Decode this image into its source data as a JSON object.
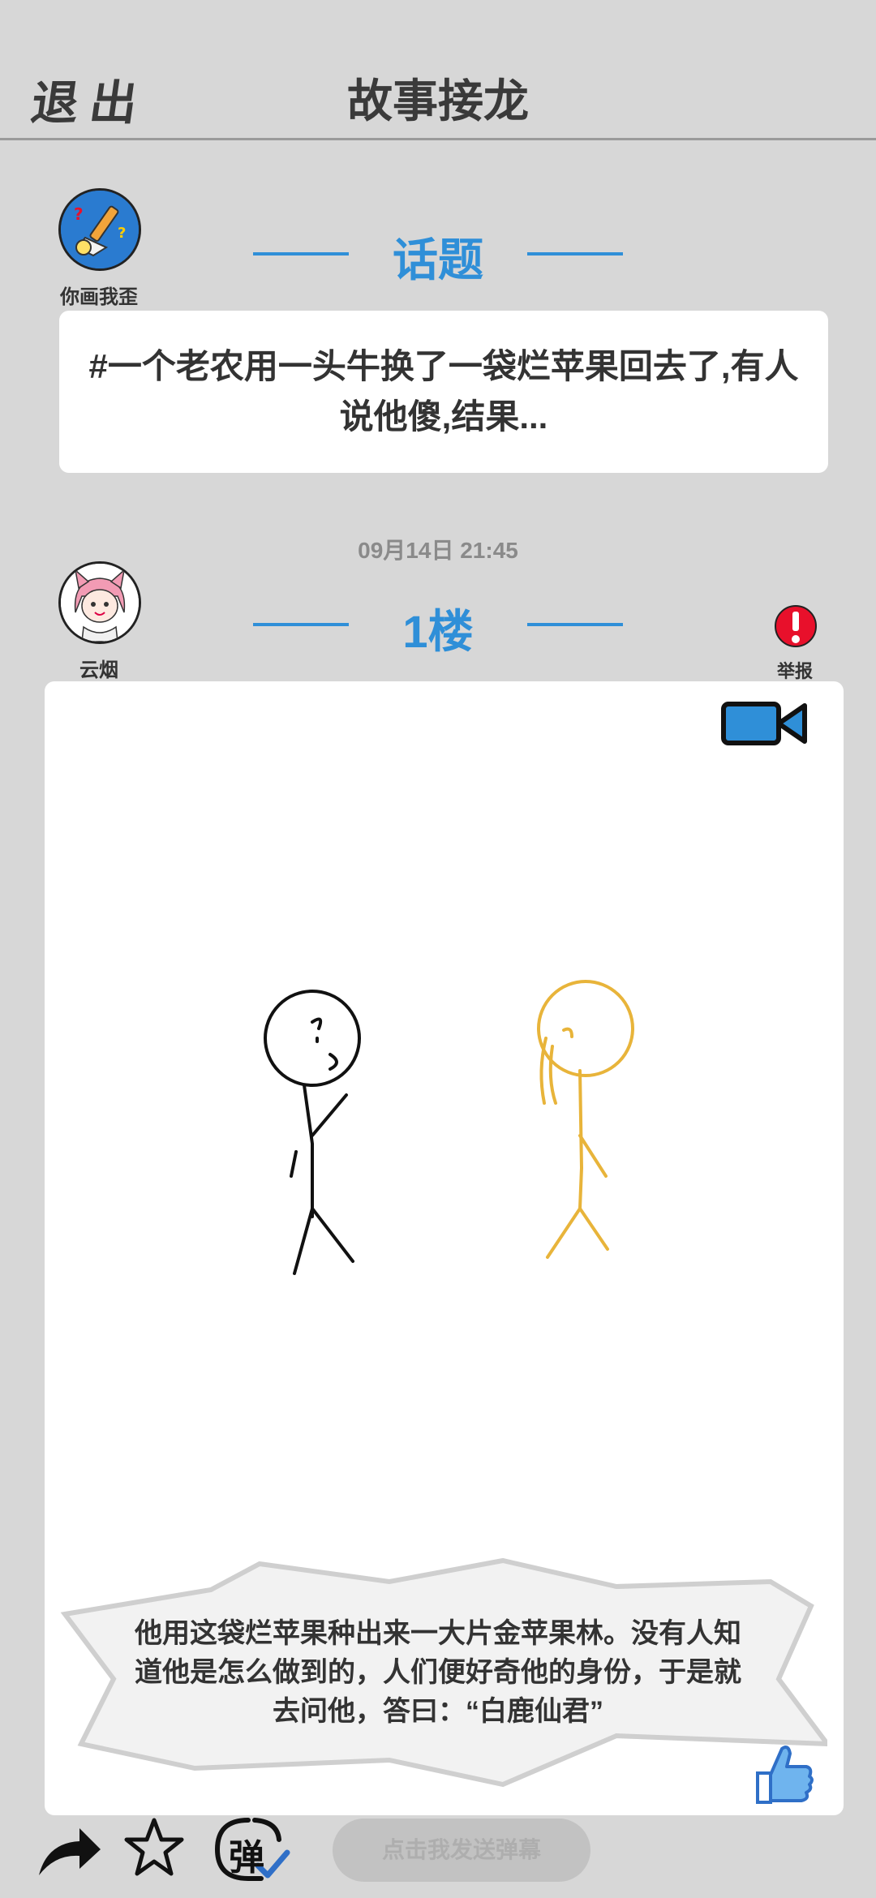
{
  "header": {
    "exit_label": "退出",
    "title": "故事接龙"
  },
  "topic": {
    "author_name": "你画我歪",
    "section_title": "话题",
    "text": "#一个老农用一头牛换了一袋烂苹果回去了,有人说他傻,结果..."
  },
  "post": {
    "timestamp": "09月14日  21:45",
    "author_name": "云烟",
    "floor_label": "1楼",
    "report_label": "举报",
    "caption": "他用这袋烂苹果种出来一大片金苹果林。没有人知道他是怎么做到的，人们便好奇他的身份，于是就去问他，答曰：“白鹿仙君”"
  },
  "bottom_bar": {
    "danmaku_placeholder": "点击我发送弹幕",
    "danmaku_icon_char": "弹"
  },
  "icons": [
    "share-icon",
    "star-icon",
    "danmaku-toggle-icon",
    "video-camera-icon",
    "report-icon",
    "like-icon"
  ],
  "colors": {
    "accent": "#2f8fd8",
    "background": "#d7d7d7",
    "report": "#e8102b",
    "drawing_figure_2": "#e8b43a"
  }
}
